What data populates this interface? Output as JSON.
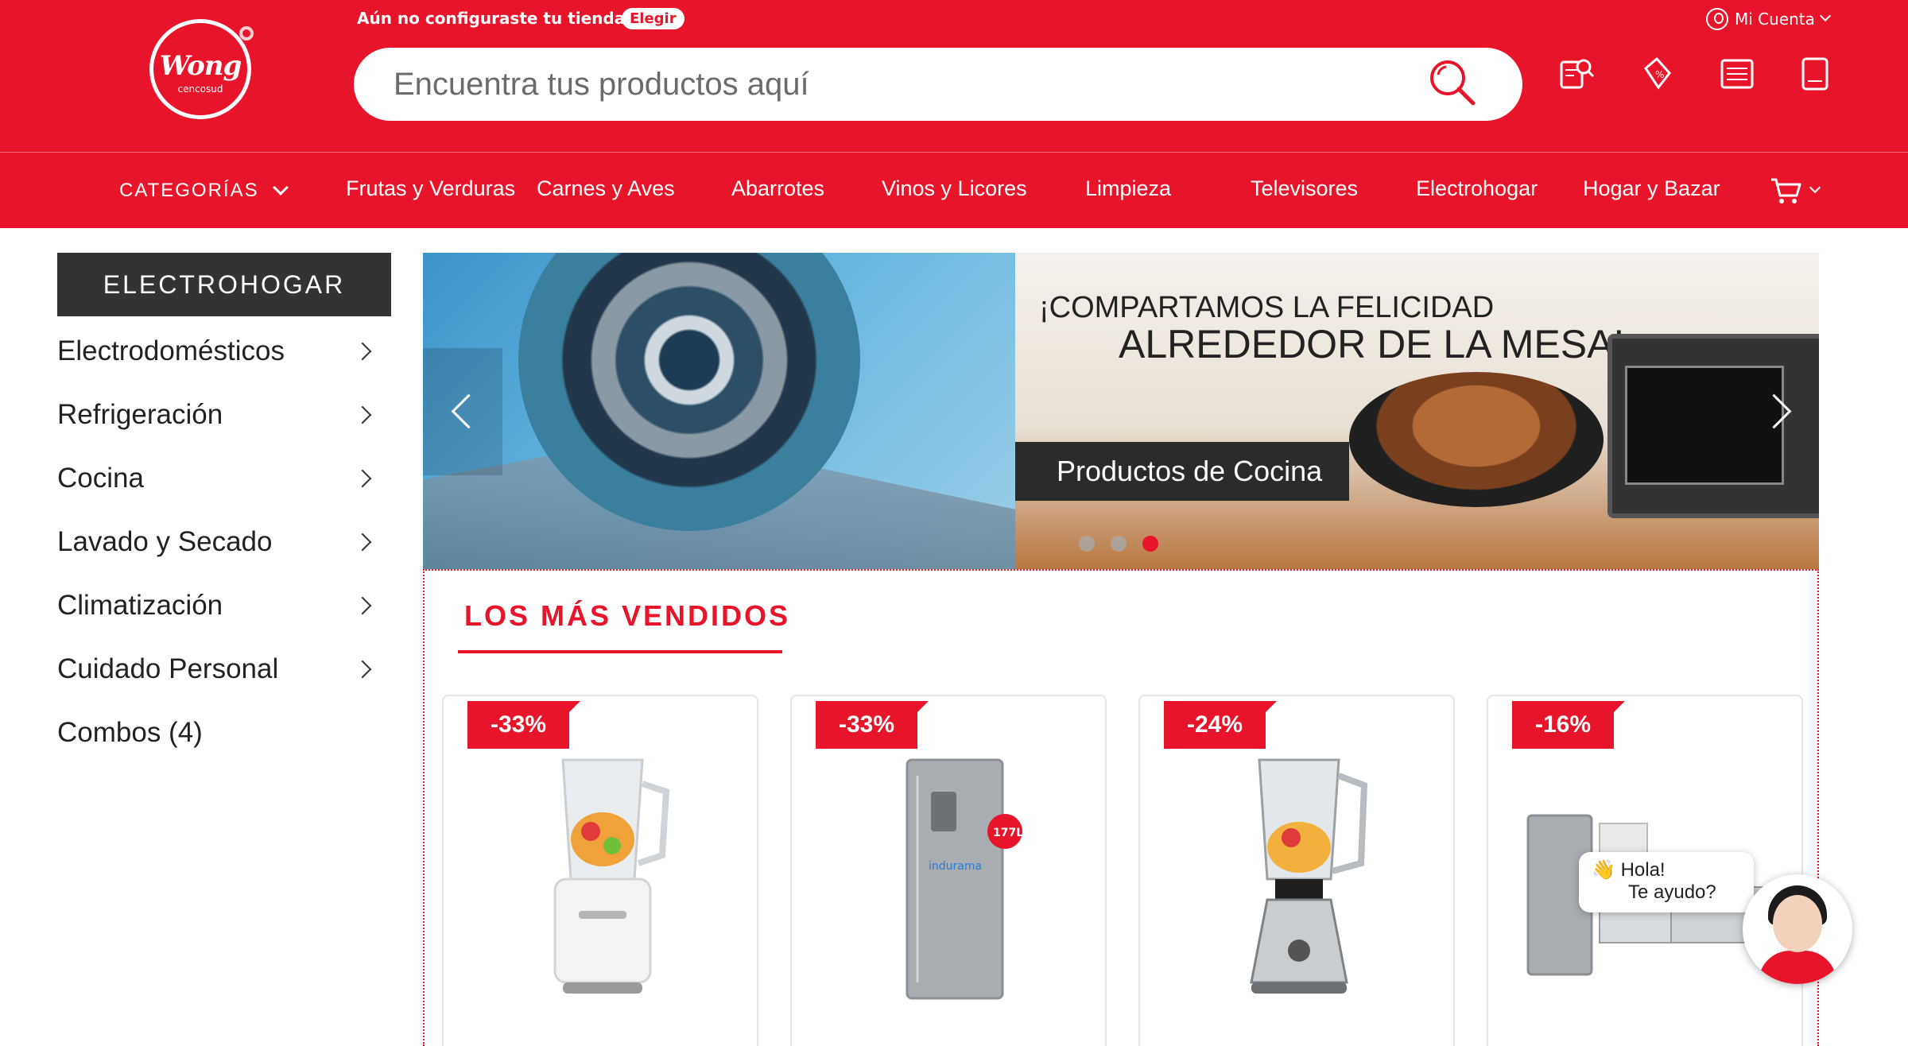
{
  "header": {
    "logo_brand": "Wong",
    "logo_sub": "cencosud",
    "store_message": "Aún no configuraste tu tienda",
    "store_button": "Elegir",
    "account_label": "Mi Cuenta",
    "search_placeholder": "Encuentra tus productos aquí",
    "icons": [
      "order-search-icon",
      "discount-tag-icon",
      "shopping-list-icon",
      "catalog-book-icon"
    ]
  },
  "nav": {
    "categories_label": "CATEGORÍAS",
    "items": [
      "Frutas y Verduras",
      "Carnes y Aves",
      "Abarrotes",
      "Vinos y Licores",
      "Limpieza",
      "Televisores",
      "Electrohogar",
      "Hogar y Bazar"
    ]
  },
  "sidebar": {
    "title": "ELECTROHOGAR",
    "items": [
      {
        "label": "Electrodomésticos",
        "has_children": true
      },
      {
        "label": "Refrigeración",
        "has_children": true
      },
      {
        "label": "Cocina",
        "has_children": true
      },
      {
        "label": "Lavado y Secado",
        "has_children": true
      },
      {
        "label": "Climatización",
        "has_children": true
      },
      {
        "label": "Cuidado Personal",
        "has_children": true
      },
      {
        "label": "Combos (4)",
        "has_children": false
      }
    ]
  },
  "banner": {
    "title_line1": "¡COMPARTAMOS LA FELICIDAD",
    "title_line2": "ALREDEDOR DE LA MESA!",
    "tag": "Productos de Cocina",
    "slides": 3,
    "active_slide": 3
  },
  "best_sellers": {
    "title": "LOS MÁS VENDIDOS",
    "products": [
      {
        "discount": "-33%",
        "kind": "blender"
      },
      {
        "discount": "-33%",
        "kind": "refrigerator",
        "size_badge": "177L",
        "brand": "indurama"
      },
      {
        "discount": "-24%",
        "kind": "blender-chrome"
      },
      {
        "discount": "-16%",
        "kind": "appliance-combo"
      }
    ]
  },
  "chat": {
    "line1": "Hola!",
    "line2": "Te ayudo?"
  },
  "colors": {
    "brand_red": "#e8142a",
    "dark": "#333333",
    "white": "#ffffff"
  }
}
